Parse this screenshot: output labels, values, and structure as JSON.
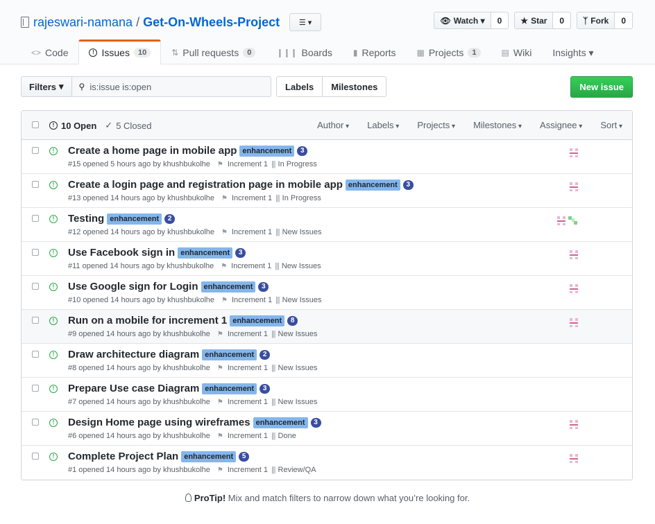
{
  "repo": {
    "owner": "rajeswari-namana",
    "separator": "/",
    "name": "Get-On-Wheels-Project",
    "list_toggle": "☰ ▾"
  },
  "actions": [
    {
      "label": "Watch ▾",
      "count": "0",
      "icon": "eye-icon"
    },
    {
      "label": "Star",
      "count": "0",
      "icon": "star-icon"
    },
    {
      "label": "Fork",
      "count": "0",
      "icon": "fork-icon"
    }
  ],
  "nav": {
    "code": "Code",
    "issues": "Issues",
    "issues_count": "10",
    "pulls": "Pull requests",
    "pulls_count": "0",
    "boards": "Boards",
    "reports": "Reports",
    "projects": "Projects",
    "projects_count": "1",
    "wiki": "Wiki",
    "insights": "Insights ▾"
  },
  "subnav": {
    "filters": "Filters",
    "search_value": "is:issue is:open",
    "labels": "Labels",
    "milestones": "Milestones",
    "new_issue": "New issue"
  },
  "box": {
    "open": "10 Open",
    "closed": "5 Closed",
    "menus": [
      "Author",
      "Labels",
      "Projects",
      "Milestones",
      "Assignee",
      "Sort"
    ]
  },
  "issues": [
    {
      "title": "Create a home page in mobile app",
      "label": "enhancement",
      "points": "3",
      "meta": "#15 opened 5 hours ago by khushbukolhe",
      "milestone": "Increment 1",
      "pipeline": "In Progress",
      "label_color": "#84b6eb"
    },
    {
      "title": "Create a login page and registration page in mobile app",
      "label": "enhancement",
      "points": "3",
      "meta": "#13 opened 14 hours ago by khushbukolhe",
      "milestone": "Increment 1",
      "pipeline": "In Progress"
    },
    {
      "title": "Testing",
      "label": "enhancement",
      "points": "2",
      "meta": "#12 opened 14 hours ago by khushbukolhe",
      "milestone": "Increment 1",
      "pipeline": "New Issues"
    },
    {
      "title": "Use Facebook sign in",
      "label": "enhancement",
      "points": "3",
      "meta": "#11 opened 14 hours ago by khushbukolhe",
      "milestone": "Increment 1",
      "pipeline": "New Issues"
    },
    {
      "title": "Use Google sign for Login",
      "label": "enhancement",
      "points": "3",
      "meta": "#10 opened 14 hours ago by khushbukolhe",
      "milestone": "Increment 1",
      "pipeline": "New Issues"
    },
    {
      "title": "Run on a mobile for increment 1",
      "label": "enhancement",
      "points": "8",
      "meta": "#9 opened 14 hours ago by khushbukolhe",
      "milestone": "Increment 1",
      "pipeline": "New Issues"
    },
    {
      "title": "Draw architecture diagram",
      "label": "enhancement",
      "points": "2",
      "meta": "#8 opened 14 hours ago by khushbukolhe",
      "milestone": "Increment 1",
      "pipeline": "New Issues"
    },
    {
      "title": "Prepare Use case Diagram",
      "label": "enhancement",
      "points": "3",
      "meta": "#7 opened 14 hours ago by khushbukolhe",
      "milestone": "Increment 1",
      "pipeline": "New Issues"
    },
    {
      "title": "Design Home page using wireframes",
      "label": "enhancement",
      "points": "3",
      "meta": "#6 opened 14 hours ago by khushbukolhe",
      "milestone": "Increment 1",
      "pipeline": "Done"
    },
    {
      "title": "Complete Project Plan",
      "label": "enhancement",
      "points": "5",
      "meta": "#1 opened 14 hours ago by khushbukolhe",
      "milestone": "Increment 1",
      "pipeline": "Review/QA"
    }
  ],
  "protip": {
    "bold": "ProTip!",
    "text": " Mix and match filters to narrow down what you’re looking for."
  }
}
